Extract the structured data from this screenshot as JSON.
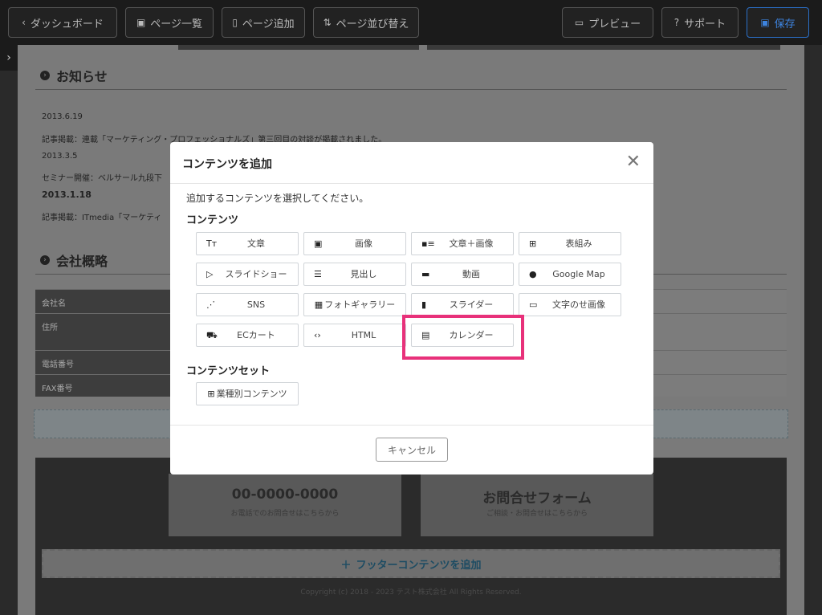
{
  "toolbar": {
    "dashboard": "ダッシュボード",
    "page_list": "ページ一覧",
    "page_add": "ページ追加",
    "page_sort": "ページ並び替え",
    "preview": "プレビュー",
    "support": "サポート",
    "save": "保存"
  },
  "page": {
    "notice_title": "お知らせ",
    "news": [
      {
        "date": "2013.6.19",
        "text": "記事掲載：連載「マーケティング・プロフェッショナルズ」第三回目の対談が掲載されました。"
      },
      {
        "date": "2013.3.5",
        "text": "セミナー開催：ベルサール九段下"
      },
      {
        "date": "2013.1.18",
        "text": "記事掲載：ITmedia「マーケティ"
      }
    ],
    "company_title": "会社概略",
    "company_rows": [
      "会社名",
      "住所",
      "電話番号",
      "FAX番号"
    ],
    "footer": {
      "tel": "00-0000-0000",
      "tel_note": "お電話でのお問合せはこちらから",
      "form": "お問合せフォーム",
      "form_note": "ご相談・お問合せはこちらから",
      "add_label": "フッターコンテンツを追加",
      "copyright": "Copyright (c) 2018 - 2023 テスト株式会社 All Rights Reserved."
    }
  },
  "modal": {
    "title": "コンテンツを追加",
    "instruction": "追加するコンテンツを選択してください。",
    "section_contents": "コンテンツ",
    "section_sets": "コンテンツセット",
    "buttons": [
      {
        "label": "文章",
        "icon": "Tт"
      },
      {
        "label": "画像",
        "icon": "▣"
      },
      {
        "label": "文章＋画像",
        "icon": "▪≡"
      },
      {
        "label": "表組み",
        "icon": "⊞"
      },
      {
        "label": "スライドショー",
        "icon": "▷"
      },
      {
        "label": "見出し",
        "icon": "☰"
      },
      {
        "label": "動画",
        "icon": "▬"
      },
      {
        "label": "Google Map",
        "icon": "●"
      },
      {
        "label": "SNS",
        "icon": "⋰"
      },
      {
        "label": "フォトギャラリー",
        "icon": "▦"
      },
      {
        "label": "スライダー",
        "icon": "▮"
      },
      {
        "label": "文字のせ画像",
        "icon": "▭"
      },
      {
        "label": "ECカート",
        "icon": "⛟"
      },
      {
        "label": "HTML",
        "icon": "‹›"
      },
      {
        "label": "カレンダー",
        "icon": "▤"
      }
    ],
    "set_button": "業種別コンテンツ",
    "cancel": "キャンセル"
  },
  "colors": {
    "highlight": "#e8317a",
    "save_accent": "#3d84e0"
  }
}
